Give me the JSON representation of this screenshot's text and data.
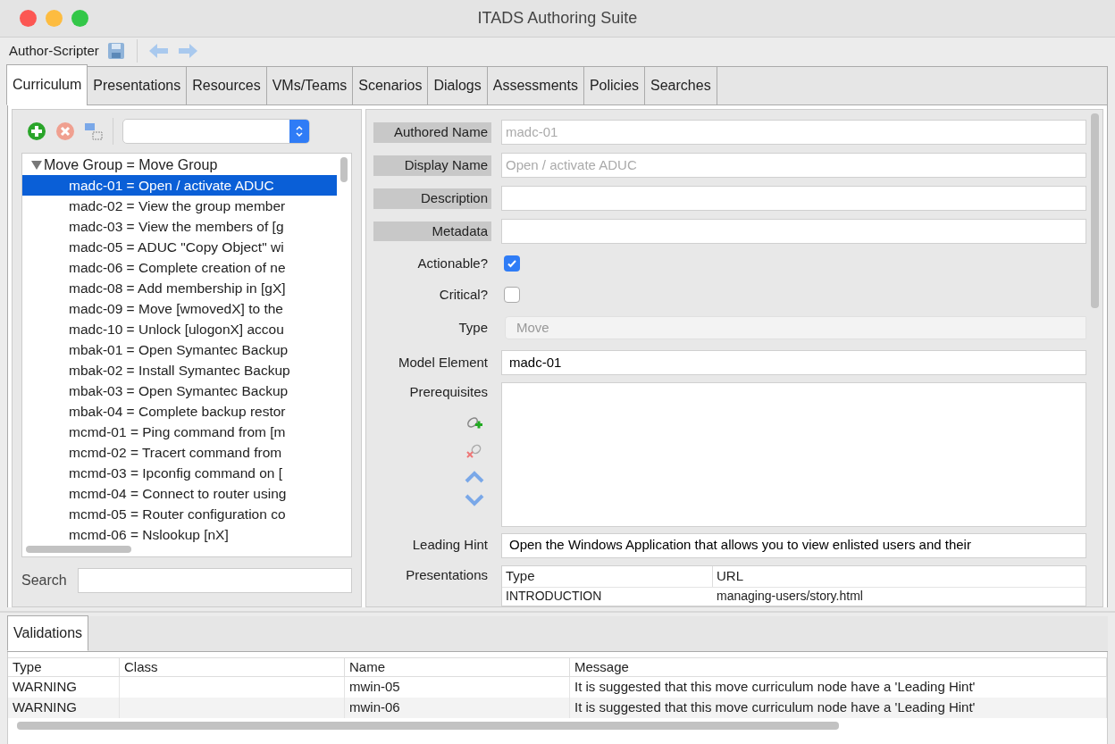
{
  "window": {
    "title": "ITADS Authoring Suite"
  },
  "toolbar": {
    "label": "Author-Scripter"
  },
  "tabs": [
    {
      "label": "Curriculum",
      "selected": true
    },
    {
      "label": "Presentations",
      "selected": false
    },
    {
      "label": "Resources",
      "selected": false
    },
    {
      "label": "VMs/Teams",
      "selected": false
    },
    {
      "label": "Scenarios",
      "selected": false
    },
    {
      "label": "Dialogs",
      "selected": false
    },
    {
      "label": "Assessments",
      "selected": false
    },
    {
      "label": "Policies",
      "selected": false
    },
    {
      "label": "Searches",
      "selected": false
    }
  ],
  "tree": {
    "label": "Move Group = Move Group",
    "expanded": true,
    "children": [
      {
        "label": "madc-01 = Open / activate ADUC",
        "selected": true
      },
      {
        "label": "madc-02 = View the group member",
        "selected": false
      },
      {
        "label": "madc-03 = View the members of [g",
        "selected": false
      },
      {
        "label": "madc-05 = ADUC \"Copy Object\" wi",
        "selected": false
      },
      {
        "label": "madc-06 = Complete creation of ne",
        "selected": false
      },
      {
        "label": "madc-08 = Add membership in [gX]",
        "selected": false
      },
      {
        "label": "madc-09 = Move [wmovedX] to the",
        "selected": false
      },
      {
        "label": "madc-10 = Unlock [ulogonX] accou",
        "selected": false
      },
      {
        "label": "mbak-01 = Open Symantec Backup",
        "selected": false
      },
      {
        "label": "mbak-02 = Install Symantec Backup",
        "selected": false
      },
      {
        "label": "mbak-03 = Open Symantec Backup",
        "selected": false
      },
      {
        "label": "mbak-04 = Complete backup restor",
        "selected": false
      },
      {
        "label": "mcmd-01 = Ping command from [m",
        "selected": false
      },
      {
        "label": "mcmd-02 = Tracert command from",
        "selected": false
      },
      {
        "label": "mcmd-03 = Ipconfig command on [",
        "selected": false
      },
      {
        "label": "mcmd-04 = Connect to router using",
        "selected": false
      },
      {
        "label": "mcmd-05 = Router configuration co",
        "selected": false
      },
      {
        "label": "mcmd-06 = Nslookup [nX]",
        "selected": false
      }
    ]
  },
  "search": {
    "label": "Search"
  },
  "form": [
    {
      "kind": "readonly",
      "label": "Authored Name",
      "value": "madc-01"
    },
    {
      "kind": "readonly",
      "label": "Display Name",
      "value": "Open / activate ADUC"
    },
    {
      "kind": "text",
      "label": "Description"
    },
    {
      "kind": "text",
      "label": "Metadata"
    },
    {
      "kind": "checkbox",
      "label": "Actionable?",
      "checked": true
    },
    {
      "kind": "checkbox",
      "label": "Critical?",
      "checked": false
    },
    {
      "kind": "select",
      "label": "Type",
      "value": "Move"
    },
    {
      "kind": "plain",
      "label": "Model Element",
      "value": "madc-01"
    },
    {
      "kind": "list",
      "label": "Prerequisites"
    },
    {
      "kind": "plain",
      "label": "Leading Hint",
      "value": "Open the Windows Application that allows you to view enlisted users and their"
    }
  ],
  "presentations": {
    "label": "Presentations",
    "columns": [
      "Type",
      "URL"
    ],
    "rows": [
      [
        "INTRODUCTION",
        "managing-users/story.html"
      ]
    ]
  },
  "validations": {
    "tab": "Validations",
    "columns": [
      "Type",
      "Class",
      "Name",
      "Message"
    ],
    "rows": [
      [
        "WARNING",
        "",
        "mwin-05",
        "It is suggested that this move curriculum node have a 'Leading Hint'"
      ],
      [
        "WARNING",
        "",
        "mwin-06",
        "It is suggested that this move curriculum node have a 'Leading Hint'"
      ]
    ]
  }
}
